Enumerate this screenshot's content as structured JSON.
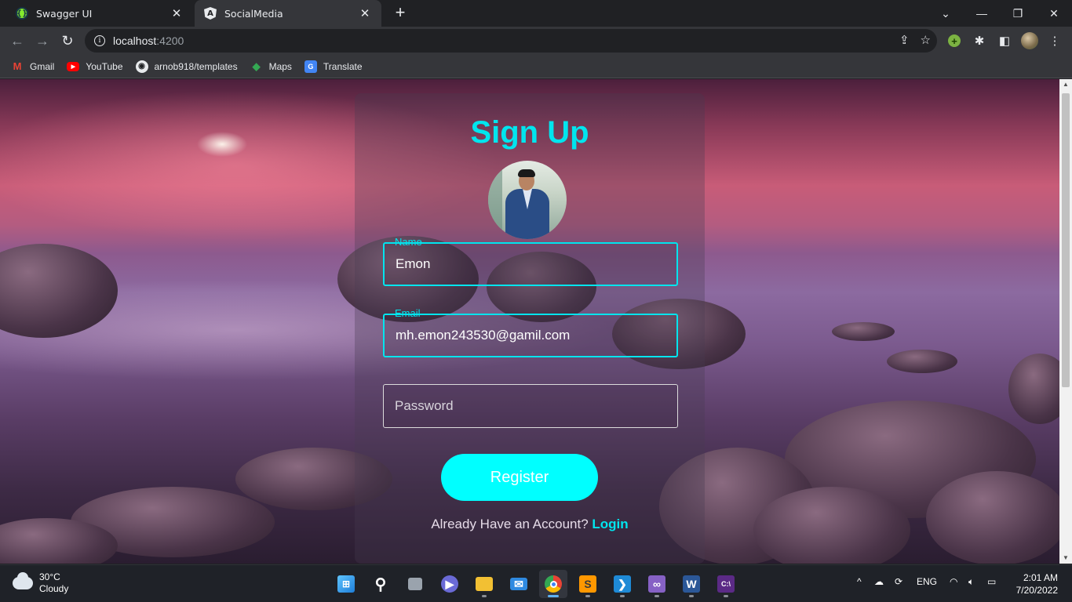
{
  "browser": {
    "tabs": [
      {
        "title": "Swagger UI",
        "active": false
      },
      {
        "title": "SocialMedia",
        "active": true
      }
    ],
    "url_host": "localhost",
    "url_port": ":4200",
    "bookmarks": [
      {
        "label": "Gmail",
        "icon": "gmail-icon"
      },
      {
        "label": "YouTube",
        "icon": "youtube-icon"
      },
      {
        "label": "arnob918/templates",
        "icon": "github-icon"
      },
      {
        "label": "Maps",
        "icon": "maps-icon"
      },
      {
        "label": "Translate",
        "icon": "translate-icon"
      }
    ]
  },
  "page": {
    "title": "Sign Up",
    "fields": {
      "name": {
        "legend": "Name",
        "value": "Emon"
      },
      "email": {
        "legend": "Email",
        "value": "mh.emon243530@gamil.com"
      },
      "password": {
        "placeholder": "Password",
        "value": ""
      }
    },
    "register_label": "Register",
    "login_prompt": "Already Have an Account?",
    "login_link": "Login",
    "colors": {
      "accent": "#00e5ee",
      "button": "#00ffff"
    }
  },
  "taskbar": {
    "weather_temp": "30°C",
    "weather_desc": "Cloudy",
    "language": "ENG",
    "time": "2:01 AM",
    "date": "7/20/2022",
    "apps": [
      "start-icon",
      "search-icon",
      "task-view-icon",
      "meet-icon",
      "file-explorer-icon",
      "mail-icon",
      "chrome-icon",
      "sublime-text-icon",
      "vscode-icon",
      "visual-studio-icon",
      "word-icon",
      "terminal-icon"
    ]
  }
}
